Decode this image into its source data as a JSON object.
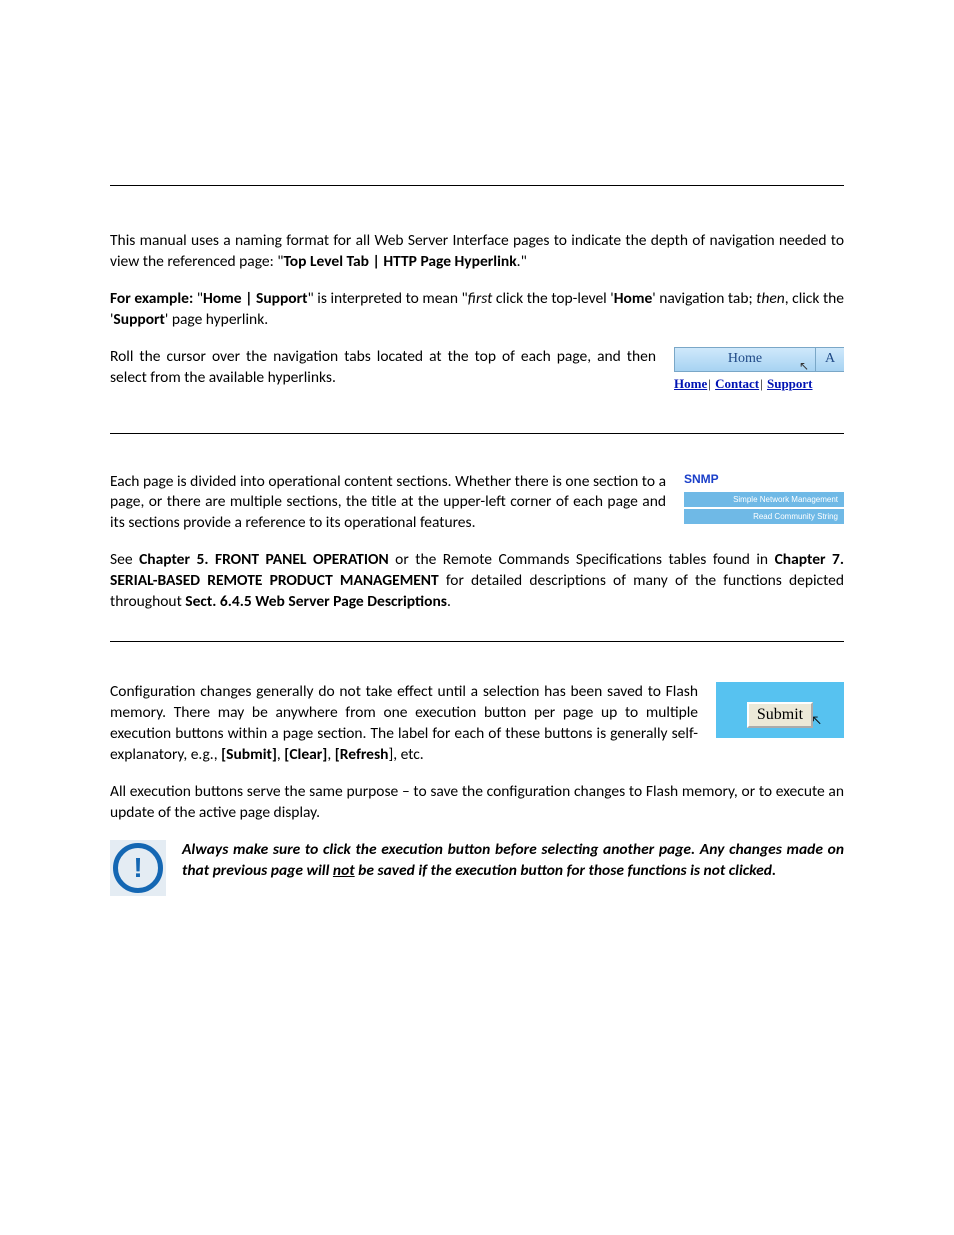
{
  "section1": {
    "p1_a": "This manual uses a naming format for all Web Server Interface pages to indicate the depth of navigation needed to view the referenced page: \"",
    "p1_bold": "Top Level Tab | HTTP Page Hyperlink",
    "p1_b": ".\"",
    "p2_bold1": "For example:",
    "p2_a": " \"",
    "p2_bold2": "Home | Support",
    "p2_b": "\" is interpreted to mean \"",
    "p2_ital1": "first",
    "p2_c": " click the top-level '",
    "p2_bold3": "Home",
    "p2_d": "' navigation tab; ",
    "p2_ital2": "then",
    "p2_e": ", click the '",
    "p2_bold4": "Support",
    "p2_f": "' page hyperlink.",
    "p3": "Roll the cursor over the navigation tabs located at the top of each page, and then select from the available hyperlinks.",
    "nav": {
      "tab_main": "Home",
      "tab_part": "A",
      "link1": "Home",
      "link2": "Contact",
      "link3": "Support"
    }
  },
  "section2": {
    "p1": "Each page is divided into operational content sections. Whether there is one section to a page, or there are multiple sections, the title at the upper-left corner of each page and its sections provide a reference to its operational features.",
    "snmp": {
      "title": "SNMP",
      "row1": "Simple Network Management",
      "row2": "Read Community String"
    },
    "p2_a": "See ",
    "p2_bold1": "Chapter 5. FRONT PANEL OPERATION",
    "p2_b": " or the Remote Commands Specifications tables found in ",
    "p2_bold2": "Chapter 7. SERIAL-BASED REMOTE PRODUCT MANAGEMENT",
    "p2_c": " for detailed descriptions of many of the functions depicted throughout ",
    "p2_bold3": "Sect. 6.4.5 Web Server Page Descriptions",
    "p2_d": "."
  },
  "section3": {
    "p1_a": "Configuration changes generally do not take effect until a selection has been saved to Flash memory. There may be anywhere from one execution button per page up to multiple execution buttons within a page section. The label for each of these buttons is generally self-explanatory, e.g., ",
    "p1_b1": "[Submit]",
    "p1_s1": ", ",
    "p1_b2": "[Clear]",
    "p1_s2": ", ",
    "p1_b3": "[Refresh",
    "p1_b": "], etc.",
    "submit_label": "Submit",
    "p2": "All execution buttons serve the same purpose – to save the configuration changes to Flash memory, or to execute an update of the active page display.",
    "warn_a": "Always make sure to click the execution button before selecting another page. Any changes made on that previous page will ",
    "warn_uline": "not",
    "warn_b": " be saved if the execution button for those functions is not clicked."
  }
}
